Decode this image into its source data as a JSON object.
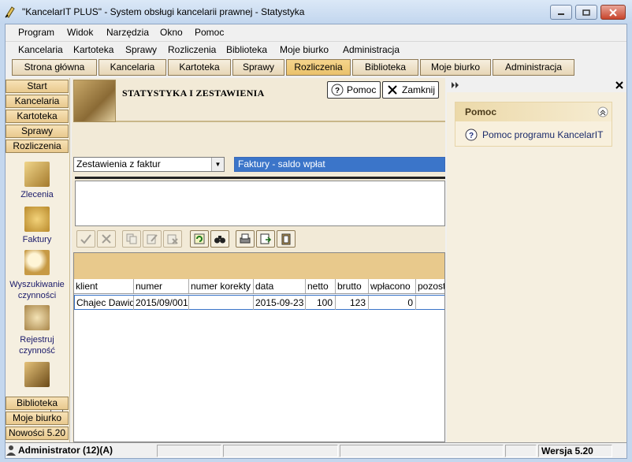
{
  "window": {
    "title": "\"KancelarIT PLUS\" - System obsługi kancelarii prawnej - Statystyka"
  },
  "menu_main": [
    "Program",
    "Widok",
    "Narzędzia",
    "Okno",
    "Pomoc"
  ],
  "menu_modules": [
    "Kancelaria",
    "Kartoteka",
    "Sprawy",
    "Rozliczenia",
    "Biblioteka",
    "Moje biurko",
    "Administracja"
  ],
  "tabs": [
    "Strona główna",
    "Kancelaria",
    "Kartoteka",
    "Sprawy",
    "Rozliczenia",
    "Biblioteka",
    "Moje biurko",
    "Administracja"
  ],
  "active_tab": "Rozliczenia",
  "sidebar": {
    "top_buttons": [
      "Start",
      "Kancelaria",
      "Kartoteka",
      "Sprawy",
      "Rozliczenia"
    ],
    "items": [
      "Zlecenia",
      "Faktury",
      "Wyszukiwanie czynności",
      "Rejestruj czynność"
    ],
    "item_lines": [
      [
        "Zlecenia"
      ],
      [
        "Faktury"
      ],
      [
        "Wyszukiwanie",
        "czynności"
      ],
      [
        "Rejestruj",
        "czynność"
      ]
    ],
    "bottom_buttons": [
      "Biblioteka",
      "Moje biurko",
      "Nowości 5.20"
    ]
  },
  "header": {
    "title": "STATYSTYKA I ZESTAWIENIA",
    "help_button": "Pomoc",
    "close_button": "Zamknij"
  },
  "filters": {
    "report_group": "Zestawienia z faktur",
    "report_type": "Faktury - saldo wpłat"
  },
  "table": {
    "columns": [
      "klient",
      "numer",
      "numer korekty",
      "data",
      "netto",
      "brutto",
      "wpłacono",
      "pozosta"
    ],
    "rows": [
      [
        "Chajec Dawid",
        "2015/09/001",
        "",
        "2015-09-23",
        "100",
        "123",
        "0",
        ""
      ]
    ]
  },
  "help_panel": {
    "section_title": "Pomoc",
    "link": "Pomoc programu KancelarIT"
  },
  "status": {
    "user": "Administrator (12)(A)",
    "version": "Wersja 5.20"
  },
  "colors": {
    "accent": "#e9c07a",
    "selection": "#3b75c9",
    "panel_bg": "#f5efe0"
  }
}
